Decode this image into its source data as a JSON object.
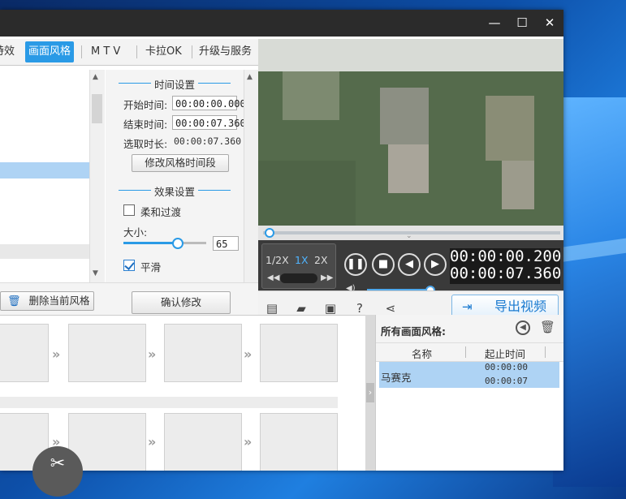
{
  "window": {
    "close": "✕",
    "maximize": "☐",
    "minimize": "—"
  },
  "tabs": [
    {
      "label": "特效"
    },
    {
      "label": "画面风格"
    },
    {
      "label": "M T V"
    },
    {
      "label": "卡拉OK"
    },
    {
      "label": "升级与服务"
    }
  ],
  "time_settings": {
    "title": "时间设置",
    "start_label": "开始时间:",
    "start_value": "00:00:00.000",
    "end_label": "结束时间:",
    "end_value": "00:00:07.360",
    "duration_label": "选取时长:",
    "duration_value": "00:00:07.360",
    "modify_btn": "修改风格时间段"
  },
  "effect_settings": {
    "title": "效果设置",
    "soft_transition": "柔和过渡",
    "size_label": "大小:",
    "size_value": "65",
    "size_level": 0.65,
    "smooth": "平滑"
  },
  "actions": {
    "delete_style": "删除当前风格",
    "confirm": "确认修改"
  },
  "player": {
    "speeds": [
      "1/2X",
      "1X",
      "2X"
    ],
    "current_time": "00:00:00.200",
    "total_time": "00:00:07.360",
    "export": "导出视频"
  },
  "effects_list": {
    "title": "所有画面风格:",
    "col_name": "名称",
    "col_time": "起止时间",
    "rows": [
      {
        "name": "马赛克",
        "start": "00:00:00",
        "end": "00:00:07"
      }
    ]
  },
  "colors": {
    "accent": "#2a9ae6",
    "selection": "#aed3f4",
    "titlebar": "#2b2b2b"
  }
}
